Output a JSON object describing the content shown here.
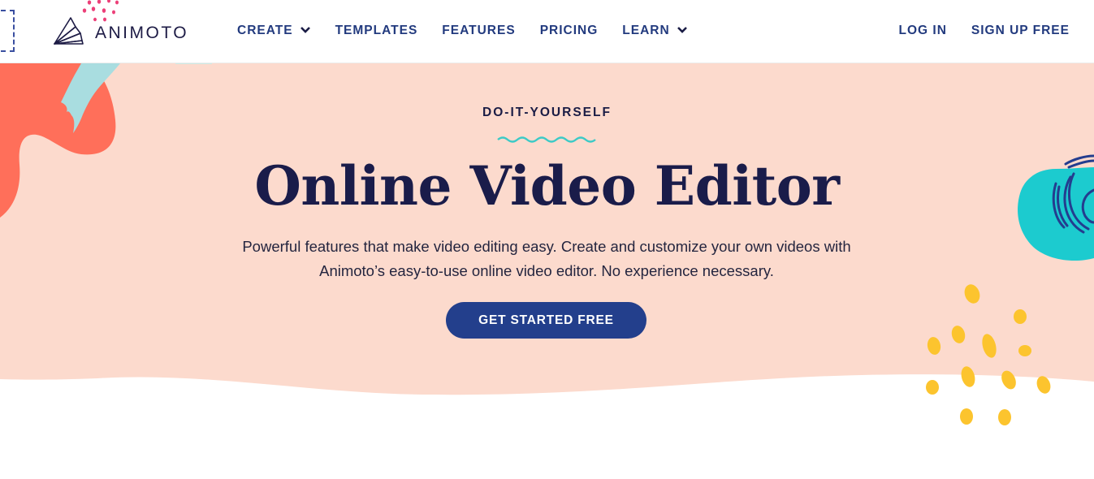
{
  "brand": {
    "name": "ANIMOTO",
    "colors": {
      "navy": "#1a1c4a",
      "nav_blue": "#223a7e",
      "button_blue": "#233f8c",
      "hero_bg": "#fcdacd",
      "coral": "#ff6f5a",
      "light_teal": "#a9dde0",
      "teal": "#1ccbcf",
      "yellow": "#fcc42e",
      "pink": "#ec3f78"
    }
  },
  "nav": {
    "items": [
      {
        "label": "CREATE",
        "has_dropdown": true,
        "icon": "chevron-down-icon"
      },
      {
        "label": "TEMPLATES",
        "has_dropdown": false
      },
      {
        "label": "FEATURES",
        "has_dropdown": false
      },
      {
        "label": "PRICING",
        "has_dropdown": false
      },
      {
        "label": "LEARN",
        "has_dropdown": true,
        "icon": "chevron-down-icon"
      }
    ],
    "right": [
      {
        "label": "LOG IN"
      },
      {
        "label": "SIGN UP FREE"
      }
    ]
  },
  "hero": {
    "eyebrow": "DO-IT-YOURSELF",
    "title": "Online Video Editor",
    "subtitle_line1": "Powerful features that make video editing easy. Create and customize your own videos with",
    "subtitle_line2": "Animoto’s easy-to-use online video editor. No experience necessary.",
    "cta_label": "GET STARTED FREE"
  }
}
